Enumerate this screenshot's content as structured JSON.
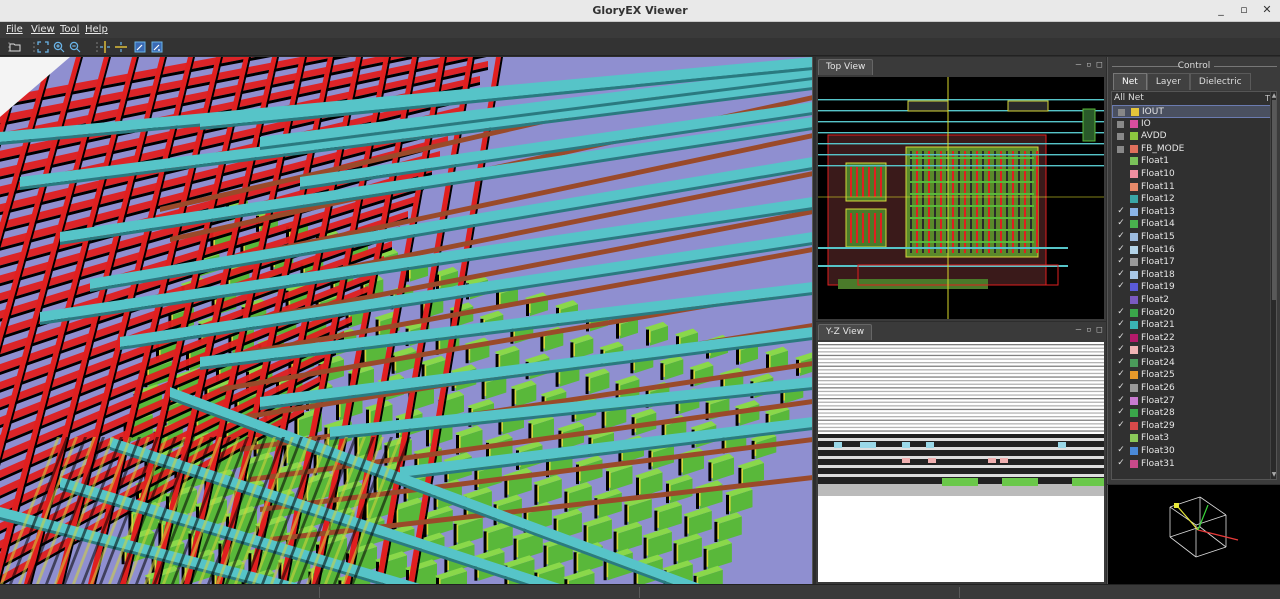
{
  "window": {
    "title": "GloryEX Viewer",
    "minimize": "_",
    "restore": "▫",
    "close": "✕"
  },
  "menu": [
    "File",
    "View",
    "Tool",
    "Help"
  ],
  "panels": {
    "top_view": {
      "tab": "Top View"
    },
    "yz_view": {
      "tab": "Y-Z View"
    }
  },
  "control": {
    "title": "Control",
    "tabs": [
      "Net",
      "Layer",
      "Dielectric"
    ],
    "header": "All Net",
    "header_right": "T",
    "nets": [
      {
        "name": "IOUT",
        "checked": "box",
        "color": "#e6c63a",
        "selected": true
      },
      {
        "name": "IO",
        "checked": "box",
        "color": "#d84d9d"
      },
      {
        "name": "AVDD",
        "checked": "box",
        "color": "#8cc63f"
      },
      {
        "name": "FB_MODE",
        "checked": "box",
        "color": "#e0705c"
      },
      {
        "name": "Float1",
        "checked": "",
        "color": "#7ac25a"
      },
      {
        "name": "Float10",
        "checked": "",
        "color": "#f08fa0"
      },
      {
        "name": "Float11",
        "checked": "",
        "color": "#e88a6a"
      },
      {
        "name": "Float12",
        "checked": "",
        "color": "#3aa6a6"
      },
      {
        "name": "Float13",
        "checked": "✓",
        "color": "#8ab4e8"
      },
      {
        "name": "Float14",
        "checked": "✓",
        "color": "#49b24e"
      },
      {
        "name": "Float15",
        "checked": "✓",
        "color": "#9dbce0"
      },
      {
        "name": "Float16",
        "checked": "✓",
        "color": "#b4d4e8"
      },
      {
        "name": "Float17",
        "checked": "✓",
        "color": "#9a9a9a"
      },
      {
        "name": "Float18",
        "checked": "✓",
        "color": "#a8c8e8"
      },
      {
        "name": "Float19",
        "checked": "✓",
        "color": "#5a5ad8"
      },
      {
        "name": "Float2",
        "checked": "",
        "color": "#7a5ac0"
      },
      {
        "name": "Float20",
        "checked": "✓",
        "color": "#3aa64a"
      },
      {
        "name": "Float21",
        "checked": "✓",
        "color": "#3ab4b4"
      },
      {
        "name": "Float22",
        "checked": "✓",
        "color": "#b41a6a"
      },
      {
        "name": "Float23",
        "checked": "✓",
        "color": "#f0b4b4"
      },
      {
        "name": "Float24",
        "checked": "✓",
        "color": "#4a9a5a"
      },
      {
        "name": "Float25",
        "checked": "✓",
        "color": "#e89a2a"
      },
      {
        "name": "Float26",
        "checked": "✓",
        "color": "#9a9a9a"
      },
      {
        "name": "Float27",
        "checked": "✓",
        "color": "#c87ad0"
      },
      {
        "name": "Float28",
        "checked": "✓",
        "color": "#3aa64a"
      },
      {
        "name": "Float29",
        "checked": "✓",
        "color": "#d84a4a"
      },
      {
        "name": "Float3",
        "checked": "",
        "color": "#8ac85a"
      },
      {
        "name": "Float30",
        "checked": "✓",
        "color": "#4a8ad8"
      },
      {
        "name": "Float31",
        "checked": "✓",
        "color": "#c84a8a"
      }
    ]
  },
  "colors": {
    "substrate": "#8f8fd0",
    "metal_red": "#e01f1f",
    "metal_cyan": "#56c4c8",
    "metal_green": "#59b83a",
    "metal_brown": "#9a4a2a",
    "metal_yellow": "#d6d63a"
  }
}
